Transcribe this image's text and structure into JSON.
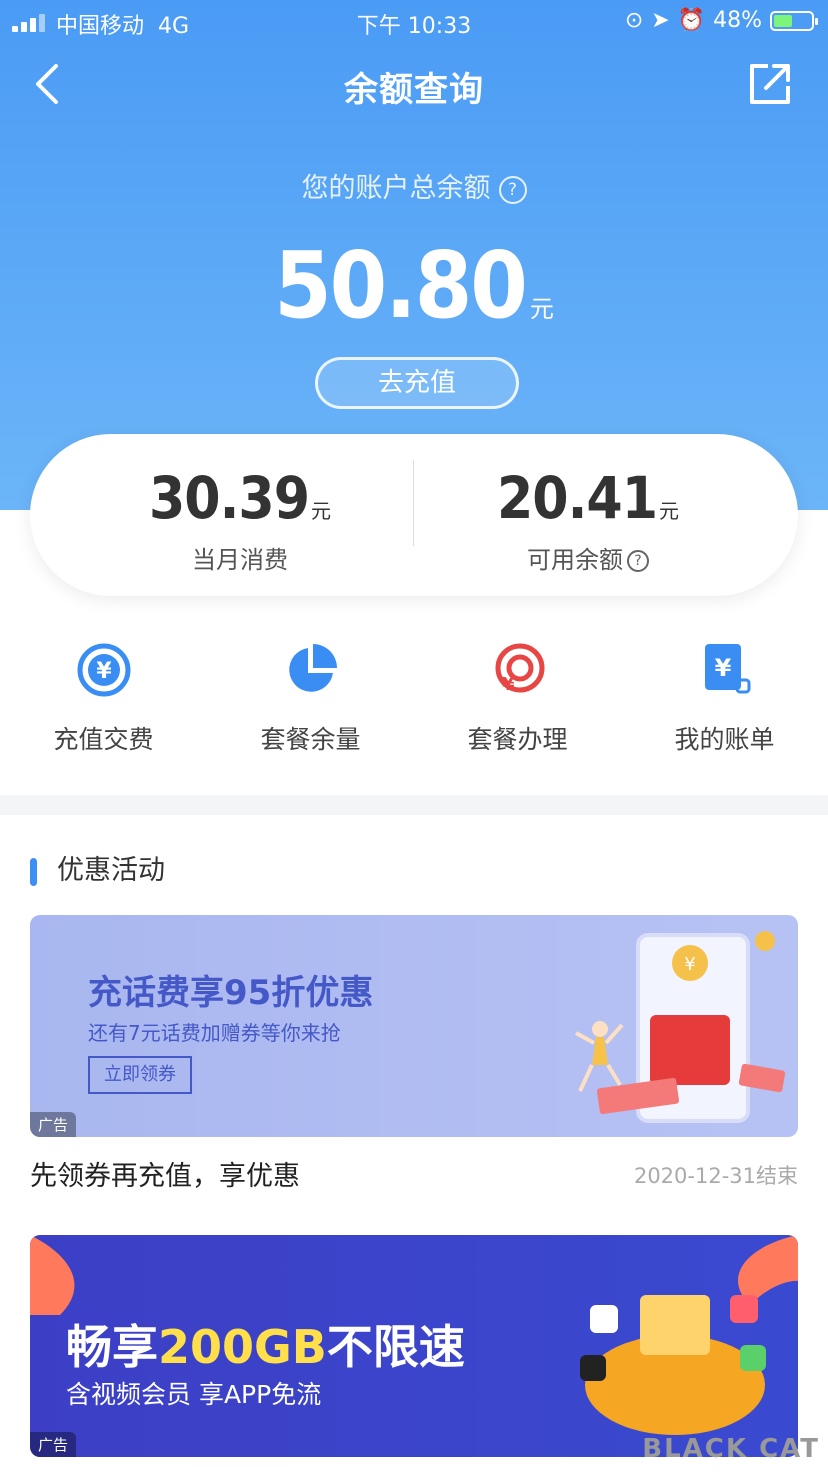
{
  "status_bar": {
    "carrier": "中国移动",
    "network": "4G",
    "time": "下午 10:33",
    "battery": "48%"
  },
  "nav": {
    "title": "余额查询"
  },
  "balance": {
    "label": "您的账户总余额",
    "amount": "50.80",
    "unit": "元",
    "recharge_label": "去充值"
  },
  "summary": {
    "monthly": {
      "value": "30.39",
      "unit": "元",
      "label": "当月消费"
    },
    "available": {
      "value": "20.41",
      "unit": "元",
      "label": "可用余额"
    }
  },
  "shortcuts": [
    {
      "label": "充值交费",
      "icon": "yuan-circle-icon"
    },
    {
      "label": "套餐余量",
      "icon": "pie-icon"
    },
    {
      "label": "套餐办理",
      "icon": "package-icon"
    },
    {
      "label": "我的账单",
      "icon": "bill-icon"
    }
  ],
  "section": {
    "title": "优惠活动"
  },
  "promo1": {
    "banner_title": "充话费享95折优惠",
    "banner_sub": "还有7元话费加赠券等你来抢",
    "banner_btn": "立即领券",
    "ad_tag": "广告",
    "title": "先领券再充值，享优惠",
    "date": "2020-12-31结束"
  },
  "promo2": {
    "title_a": "畅享",
    "title_hl": "200GB",
    "title_b": "不限速",
    "sub": "含视频会员 享APP免流",
    "ad_tag": "广告"
  },
  "watermark": {
    "text": "BLACK CAT"
  },
  "colors": {
    "accent": "#4a9bf5",
    "icon_blue": "#3a8ef3",
    "icon_red": "#e84545"
  }
}
